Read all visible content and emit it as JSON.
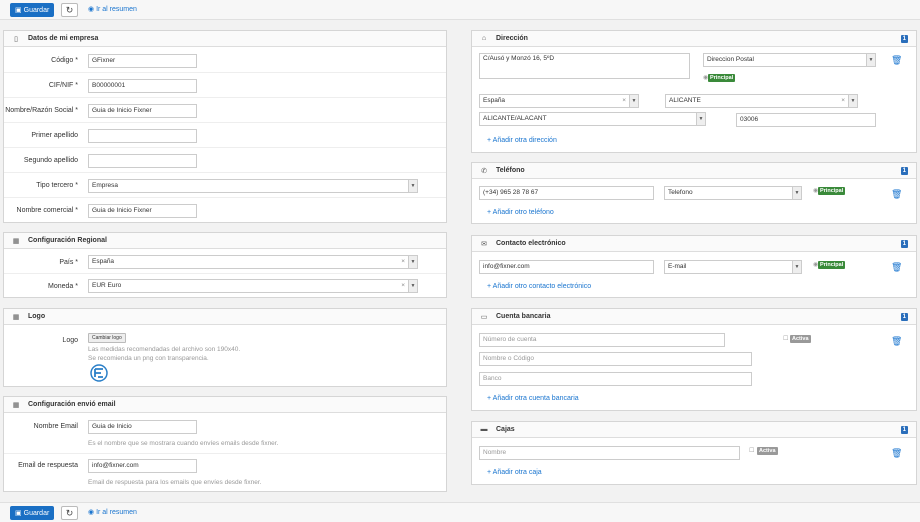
{
  "toolbar": {
    "save": "Guardar",
    "summary": "Ir al resumen"
  },
  "empresa": {
    "title": "Datos de mi empresa",
    "codigo_label": "Código *",
    "codigo": "GFixner",
    "cif_label": "CIF/NIF *",
    "cif": "B00000001",
    "nombre_label": "Nombre/Razón Social *",
    "nombre": "Guia de Inicio Fixner",
    "ape1_label": "Primer apellido",
    "ape2_label": "Segundo apellido",
    "tipo_label": "Tipo tercero *",
    "tipo": "Empresa",
    "comercial_label": "Nombre comercial *",
    "comercial": "Guia de Inicio Fixner"
  },
  "regional": {
    "title": "Configuración Regional",
    "pais_label": "País *",
    "pais": "España",
    "moneda_label": "Moneda *",
    "moneda": "EUR Euro"
  },
  "logo": {
    "title": "Logo",
    "label": "Logo",
    "button": "Cambiar logo",
    "help1": "Las medidas recomendadas del archivo son 190x40.",
    "help2": "Se recomienda un png con transparencia."
  },
  "email_cfg": {
    "title": "Configuración envió email",
    "nombre_label": "Nombre Email",
    "nombre": "Guia de Inicio",
    "nombre_help": "Es el nombre que se mostrara cuando envíes emails desde fixner.",
    "resp_label": "Email de respuesta",
    "resp": "info@fixner.com",
    "resp_help": "Email de respuesta para los emails que envíes desde fixner."
  },
  "direccion": {
    "title": "Dirección",
    "count": "1",
    "address": "C/Ausó y Monzó 16, 5ºD",
    "tipo": "Direccion Postal",
    "principal": "Principal",
    "pais": "España",
    "provincia": "ALICANTE",
    "municipio": "ALICANTE/ALACANT",
    "cp": "03006",
    "add": "+ Añadir otra dirección"
  },
  "telefono": {
    "title": "Teléfono",
    "count": "1",
    "numero": "(+34) 965 28 78 67",
    "tipo": "Telefono",
    "principal": "Principal",
    "add": "+ Añadir otro teléfono"
  },
  "contacto": {
    "title": "Contacto electrónico",
    "count": "1",
    "email": "info@fixner.com",
    "tipo": "E-mail",
    "principal": "Principal",
    "add": "+ Añadir otro contacto electrónico"
  },
  "banco": {
    "title": "Cuenta bancaria",
    "count": "1",
    "cuenta_ph": "Número de cuenta",
    "nombre_ph": "Nombre o Código",
    "banco_ph": "Banco",
    "activa": "Activa",
    "add": "+ Añadir otra cuenta bancaria"
  },
  "cajas": {
    "title": "Cajas",
    "count": "1",
    "nombre_ph": "Nombre",
    "activa": "Activa",
    "add": "+ Añadir otra caja"
  }
}
